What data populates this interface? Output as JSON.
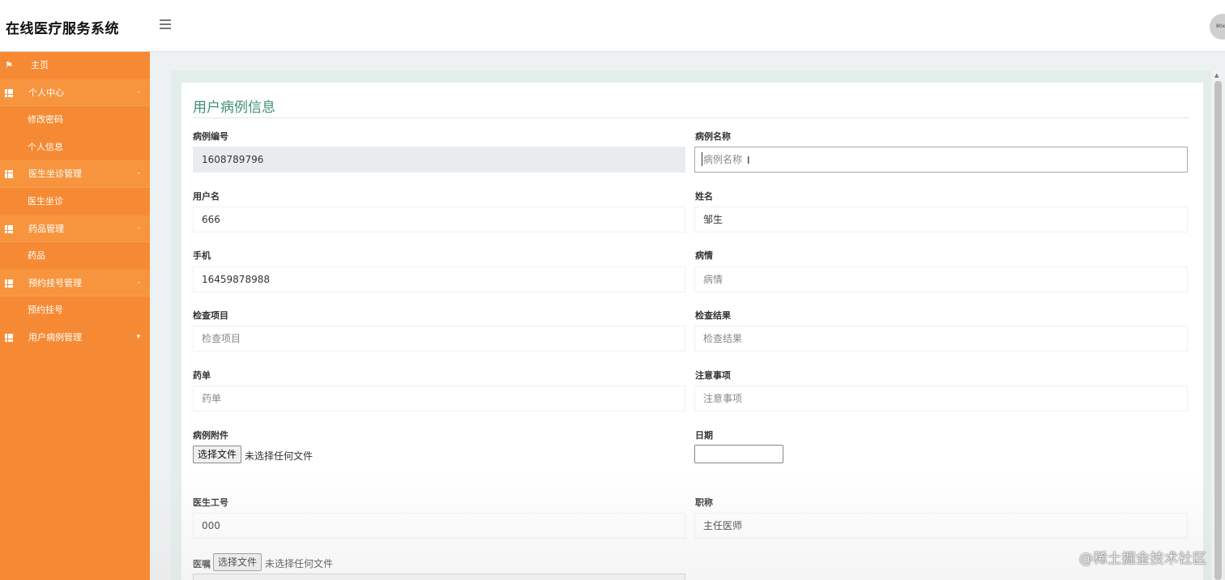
{
  "header": {
    "app_title": "在线医疗服务系统",
    "menu_icon": "hamburger-icon",
    "avatar_text": "80x"
  },
  "sidebar": {
    "items": [
      {
        "label": "主页",
        "kind": "top",
        "icon": "flag-icon"
      },
      {
        "label": "个人中心",
        "kind": "parent",
        "icon": "grid-icon",
        "caret": "-"
      },
      {
        "label": "修改密码",
        "kind": "sub"
      },
      {
        "label": "个人信息",
        "kind": "sub"
      },
      {
        "label": "医生坐诊管理",
        "kind": "parent",
        "icon": "grid-icon",
        "caret": "-"
      },
      {
        "label": "医生坐诊",
        "kind": "sub"
      },
      {
        "label": "药品管理",
        "kind": "parent",
        "icon": "grid-icon",
        "caret": "-"
      },
      {
        "label": "药品",
        "kind": "sub"
      },
      {
        "label": "预约挂号管理",
        "kind": "parent",
        "icon": "grid-icon",
        "caret": "-"
      },
      {
        "label": "预约挂号",
        "kind": "sub"
      },
      {
        "label": "用户病例管理",
        "kind": "parent",
        "icon": "grid-icon",
        "caret": "▾"
      }
    ]
  },
  "form": {
    "title": "用户病例信息",
    "case_no": {
      "label": "病例编号",
      "value": "1608789796"
    },
    "case_name": {
      "label": "病例名称",
      "placeholder": "病例名称"
    },
    "username": {
      "label": "用户名",
      "value": "666"
    },
    "name": {
      "label": "姓名",
      "value": "邹生"
    },
    "phone": {
      "label": "手机",
      "value": "16459878988"
    },
    "condition": {
      "label": "病情",
      "placeholder": "病情"
    },
    "exam_items": {
      "label": "检查项目",
      "placeholder": "检查项目"
    },
    "exam_results": {
      "label": "检查结果",
      "placeholder": "检查结果"
    },
    "prescription": {
      "label": "药单",
      "placeholder": "药单"
    },
    "notes": {
      "label": "注意事项",
      "placeholder": "注意事项"
    },
    "attachment": {
      "label": "病例附件",
      "button": "选择文件",
      "status": "未选择任何文件"
    },
    "date": {
      "label": "日期"
    },
    "doctor_id": {
      "label": "医生工号",
      "value": "000"
    },
    "title_rank": {
      "label": "职称",
      "value": "主任医师"
    },
    "advice": {
      "label": "医嘱",
      "button": "选择文件",
      "status": "未选择任何文件"
    }
  },
  "watermark": "@稀土掘金技术社区",
  "colors": {
    "sidebar": "#f68a34",
    "title_green": "#3f8f79",
    "readonly_bg": "#e9ecef"
  }
}
